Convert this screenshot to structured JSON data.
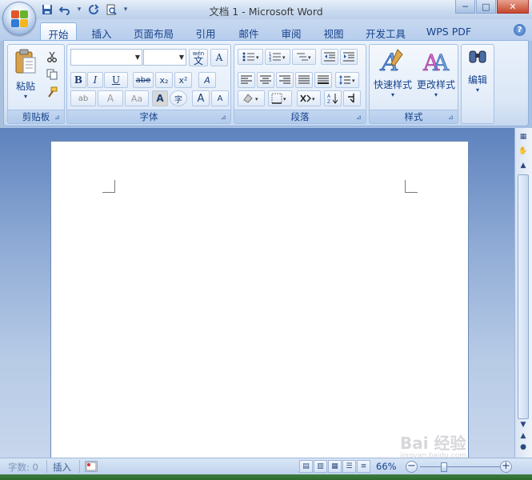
{
  "window": {
    "title": "文档 1 - Microsoft Word",
    "minimize": "─",
    "maximize": "□",
    "close": "✕"
  },
  "quick_access": {
    "save_icon": "save-icon",
    "undo_icon": "undo-icon",
    "redo_icon": "redo-icon",
    "print_preview_icon": "print-preview-icon"
  },
  "tabs": [
    {
      "label": "开始",
      "active": true
    },
    {
      "label": "插入"
    },
    {
      "label": "页面布局"
    },
    {
      "label": "引用"
    },
    {
      "label": "邮件"
    },
    {
      "label": "审阅"
    },
    {
      "label": "视图"
    },
    {
      "label": "开发工具"
    },
    {
      "label": "WPS PDF"
    }
  ],
  "ribbon": {
    "clipboard": {
      "label": "剪贴板",
      "paste": "粘贴"
    },
    "font": {
      "label": "字体",
      "font_name": "",
      "font_size": "",
      "phonetic": "wén",
      "phonetic_char": "文",
      "char_border": "A",
      "bold": "B",
      "italic": "I",
      "underline": "U",
      "strikethrough": "abe",
      "subscript": "x₂",
      "superscript": "x²",
      "clear_format": "A",
      "highlight": "ab",
      "font_color": "A",
      "change_case": "Aa",
      "char_shading": "A",
      "enclose_char": "字",
      "grow_font": "A",
      "shrink_font": "A"
    },
    "paragraph": {
      "label": "段落"
    },
    "styles": {
      "label": "样式",
      "quick_styles": "快速样式",
      "change_styles": "更改样式"
    },
    "editing": {
      "label": "编辑"
    }
  },
  "status": {
    "word_count": "字数: 0",
    "insert_mode": "插入",
    "zoom": "66%"
  },
  "watermark": {
    "text": "Bai 经验",
    "url": "jingyan.baidu.com"
  },
  "colors": {
    "accent": "#15428b",
    "ribbon_bg": "#dbe7f6",
    "doc_bg": "#8eaad5"
  }
}
